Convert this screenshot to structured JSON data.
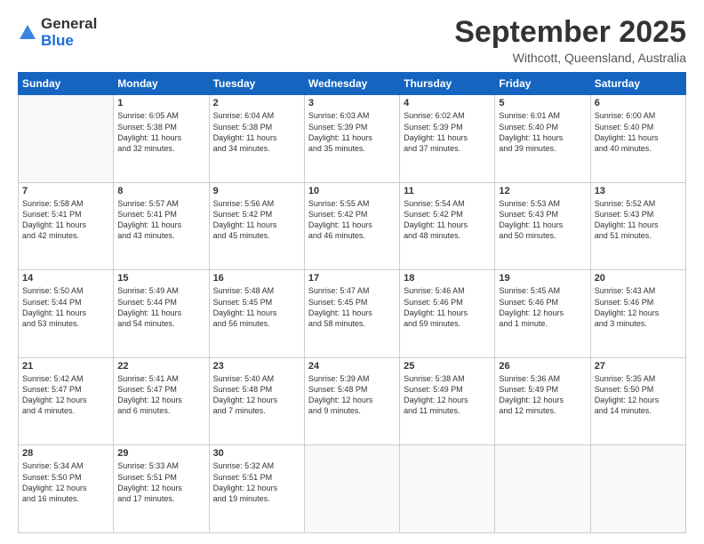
{
  "header": {
    "logo_general": "General",
    "logo_blue": "Blue",
    "month": "September 2025",
    "location": "Withcott, Queensland, Australia"
  },
  "weekdays": [
    "Sunday",
    "Monday",
    "Tuesday",
    "Wednesday",
    "Thursday",
    "Friday",
    "Saturday"
  ],
  "weeks": [
    [
      {
        "day": "",
        "info": ""
      },
      {
        "day": "1",
        "info": "Sunrise: 6:05 AM\nSunset: 5:38 PM\nDaylight: 11 hours\nand 32 minutes."
      },
      {
        "day": "2",
        "info": "Sunrise: 6:04 AM\nSunset: 5:38 PM\nDaylight: 11 hours\nand 34 minutes."
      },
      {
        "day": "3",
        "info": "Sunrise: 6:03 AM\nSunset: 5:39 PM\nDaylight: 11 hours\nand 35 minutes."
      },
      {
        "day": "4",
        "info": "Sunrise: 6:02 AM\nSunset: 5:39 PM\nDaylight: 11 hours\nand 37 minutes."
      },
      {
        "day": "5",
        "info": "Sunrise: 6:01 AM\nSunset: 5:40 PM\nDaylight: 11 hours\nand 39 minutes."
      },
      {
        "day": "6",
        "info": "Sunrise: 6:00 AM\nSunset: 5:40 PM\nDaylight: 11 hours\nand 40 minutes."
      }
    ],
    [
      {
        "day": "7",
        "info": "Sunrise: 5:58 AM\nSunset: 5:41 PM\nDaylight: 11 hours\nand 42 minutes."
      },
      {
        "day": "8",
        "info": "Sunrise: 5:57 AM\nSunset: 5:41 PM\nDaylight: 11 hours\nand 43 minutes."
      },
      {
        "day": "9",
        "info": "Sunrise: 5:56 AM\nSunset: 5:42 PM\nDaylight: 11 hours\nand 45 minutes."
      },
      {
        "day": "10",
        "info": "Sunrise: 5:55 AM\nSunset: 5:42 PM\nDaylight: 11 hours\nand 46 minutes."
      },
      {
        "day": "11",
        "info": "Sunrise: 5:54 AM\nSunset: 5:42 PM\nDaylight: 11 hours\nand 48 minutes."
      },
      {
        "day": "12",
        "info": "Sunrise: 5:53 AM\nSunset: 5:43 PM\nDaylight: 11 hours\nand 50 minutes."
      },
      {
        "day": "13",
        "info": "Sunrise: 5:52 AM\nSunset: 5:43 PM\nDaylight: 11 hours\nand 51 minutes."
      }
    ],
    [
      {
        "day": "14",
        "info": "Sunrise: 5:50 AM\nSunset: 5:44 PM\nDaylight: 11 hours\nand 53 minutes."
      },
      {
        "day": "15",
        "info": "Sunrise: 5:49 AM\nSunset: 5:44 PM\nDaylight: 11 hours\nand 54 minutes."
      },
      {
        "day": "16",
        "info": "Sunrise: 5:48 AM\nSunset: 5:45 PM\nDaylight: 11 hours\nand 56 minutes."
      },
      {
        "day": "17",
        "info": "Sunrise: 5:47 AM\nSunset: 5:45 PM\nDaylight: 11 hours\nand 58 minutes."
      },
      {
        "day": "18",
        "info": "Sunrise: 5:46 AM\nSunset: 5:46 PM\nDaylight: 11 hours\nand 59 minutes."
      },
      {
        "day": "19",
        "info": "Sunrise: 5:45 AM\nSunset: 5:46 PM\nDaylight: 12 hours\nand 1 minute."
      },
      {
        "day": "20",
        "info": "Sunrise: 5:43 AM\nSunset: 5:46 PM\nDaylight: 12 hours\nand 3 minutes."
      }
    ],
    [
      {
        "day": "21",
        "info": "Sunrise: 5:42 AM\nSunset: 5:47 PM\nDaylight: 12 hours\nand 4 minutes."
      },
      {
        "day": "22",
        "info": "Sunrise: 5:41 AM\nSunset: 5:47 PM\nDaylight: 12 hours\nand 6 minutes."
      },
      {
        "day": "23",
        "info": "Sunrise: 5:40 AM\nSunset: 5:48 PM\nDaylight: 12 hours\nand 7 minutes."
      },
      {
        "day": "24",
        "info": "Sunrise: 5:39 AM\nSunset: 5:48 PM\nDaylight: 12 hours\nand 9 minutes."
      },
      {
        "day": "25",
        "info": "Sunrise: 5:38 AM\nSunset: 5:49 PM\nDaylight: 12 hours\nand 11 minutes."
      },
      {
        "day": "26",
        "info": "Sunrise: 5:36 AM\nSunset: 5:49 PM\nDaylight: 12 hours\nand 12 minutes."
      },
      {
        "day": "27",
        "info": "Sunrise: 5:35 AM\nSunset: 5:50 PM\nDaylight: 12 hours\nand 14 minutes."
      }
    ],
    [
      {
        "day": "28",
        "info": "Sunrise: 5:34 AM\nSunset: 5:50 PM\nDaylight: 12 hours\nand 16 minutes."
      },
      {
        "day": "29",
        "info": "Sunrise: 5:33 AM\nSunset: 5:51 PM\nDaylight: 12 hours\nand 17 minutes."
      },
      {
        "day": "30",
        "info": "Sunrise: 5:32 AM\nSunset: 5:51 PM\nDaylight: 12 hours\nand 19 minutes."
      },
      {
        "day": "",
        "info": ""
      },
      {
        "day": "",
        "info": ""
      },
      {
        "day": "",
        "info": ""
      },
      {
        "day": "",
        "info": ""
      }
    ]
  ]
}
